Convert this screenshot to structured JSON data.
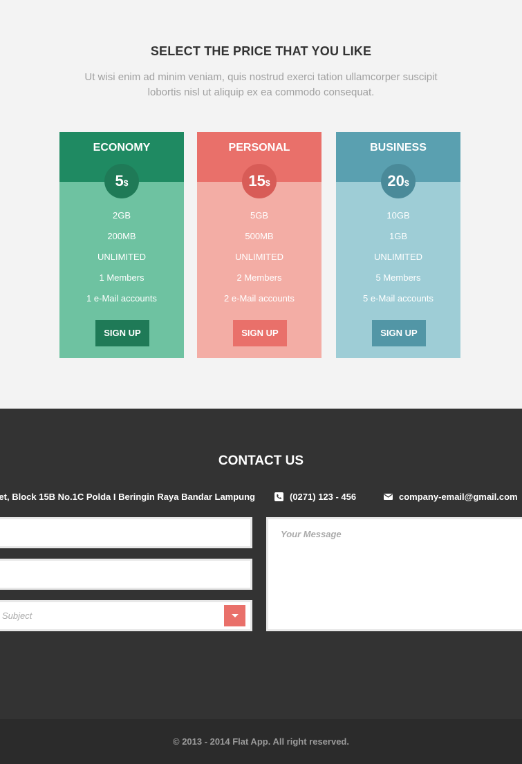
{
  "pricing": {
    "title": "SELECT THE PRICE THAT YOU LIKE",
    "subtitle": "Ut wisi enim ad minim veniam, quis nostrud exerci tation ullamcorper suscipit lobortis nisl ut aliquip ex ea commodo consequat.",
    "plans": [
      {
        "name": "ECONOMY",
        "price": "5",
        "currency": "$",
        "features": [
          "2GB",
          "200MB",
          "UNLIMITED",
          "1 Members",
          "1 e-Mail accounts"
        ],
        "button": "SIGN UP"
      },
      {
        "name": "PERSONAL",
        "price": "15",
        "currency": "$",
        "features": [
          "5GB",
          "500MB",
          "UNLIMITED",
          "2 Members",
          "2 e-Mail accounts"
        ],
        "button": "SIGN UP"
      },
      {
        "name": "BUSINESS",
        "price": "20",
        "currency": "$",
        "features": [
          "10GB",
          "1GB",
          "UNLIMITED",
          "5 Members",
          "5 e-Mail accounts"
        ],
        "button": "SIGN UP"
      }
    ]
  },
  "contact": {
    "title": "CONTACT US",
    "address": "et, Block 15B No.1C Polda I Beringin Raya Bandar Lampung",
    "phone": "(0271) 123 - 456",
    "email": "company-email@gmail.com",
    "subject_placeholder": "Subject",
    "message_placeholder": "Your Message"
  },
  "footer": {
    "copyright": "© 2013 - 2014 Flat App. All right reserved."
  },
  "colors": {
    "economy": "#1f8a62",
    "personal": "#e9706a",
    "business": "#5aa0b0",
    "dark": "#333333"
  },
  "icons": {
    "phone": "phone-icon",
    "email": "envelope-icon",
    "select": "caret-down-icon"
  }
}
